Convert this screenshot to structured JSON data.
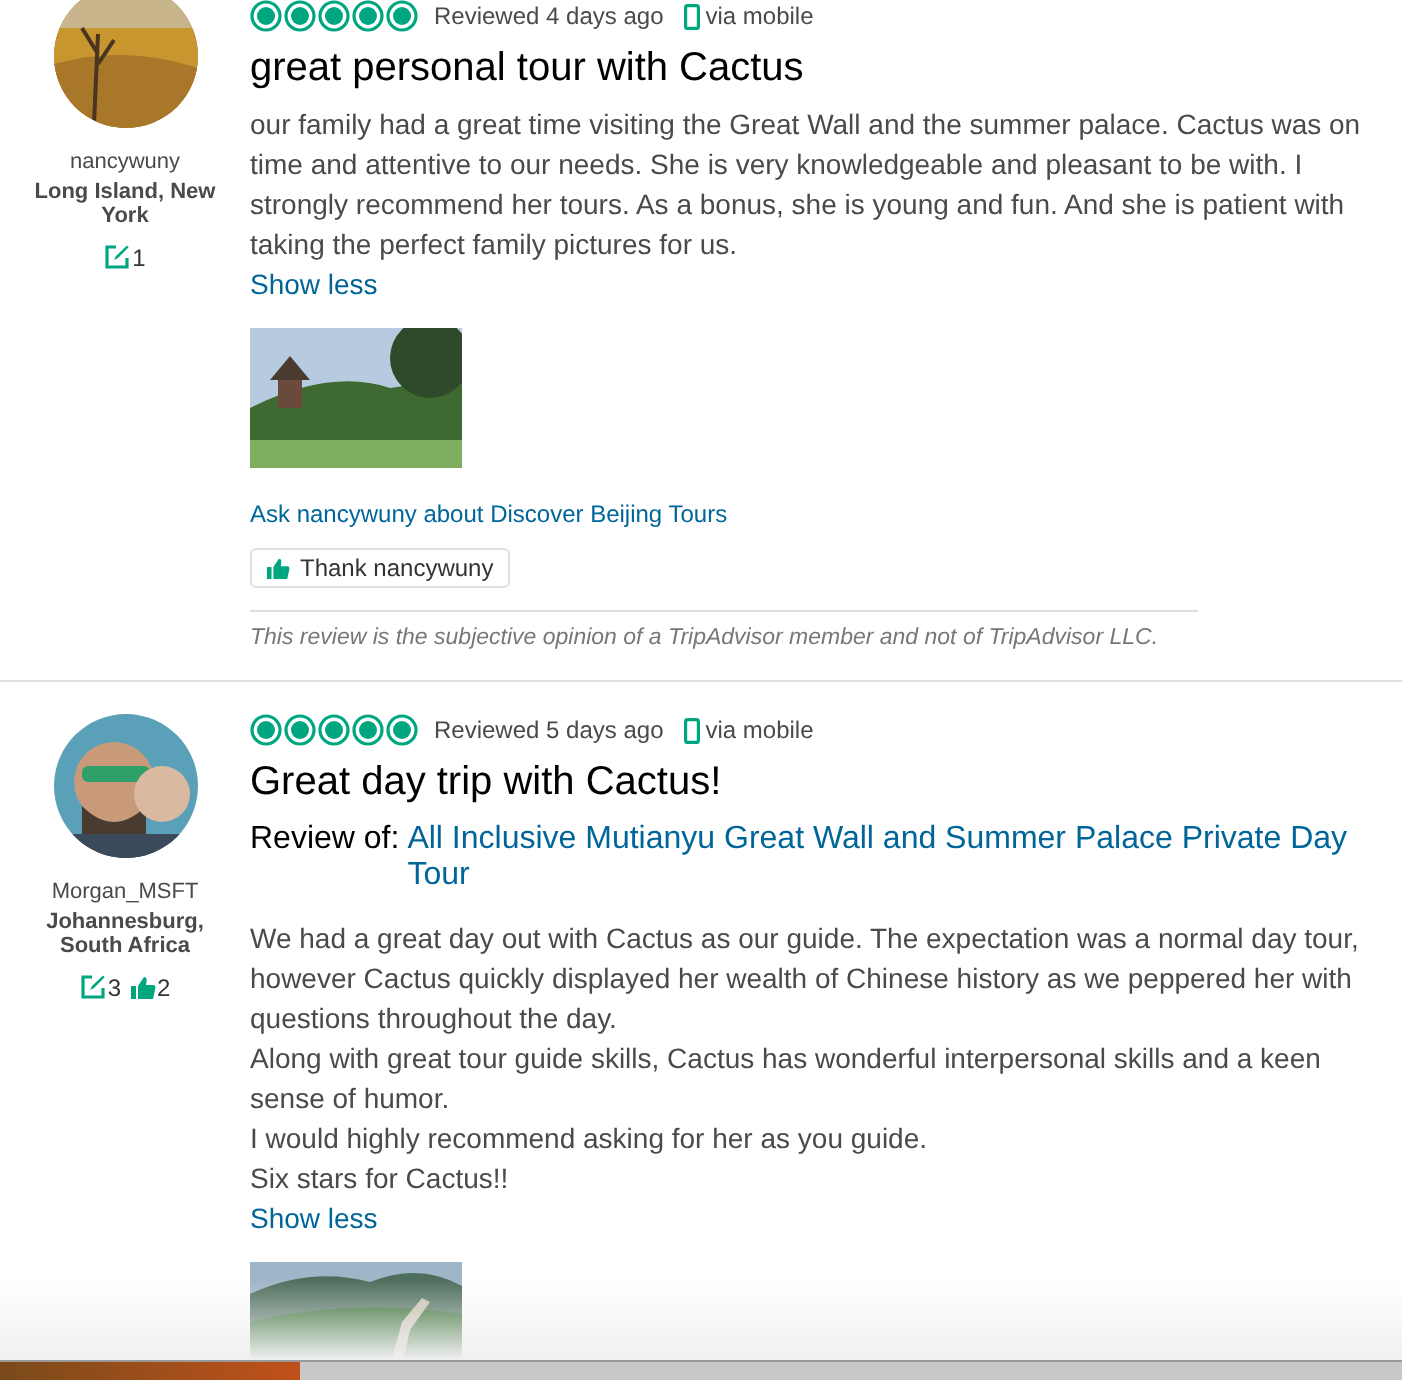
{
  "reviews": [
    {
      "username": "nancywuny",
      "location": "Long Island, New York",
      "badges": [
        {
          "kind": "reviews",
          "count": "1"
        }
      ],
      "stars": 5,
      "date": "Reviewed 4 days ago",
      "via": "via mobile",
      "title": "great personal tour with Cactus",
      "paragraphs": [
        "our family had a great time visiting the Great Wall and the summer palace. Cactus was on time and attentive to our needs. She is very knowledgeable and pleasant to be with. I strongly recommend her tours. As a bonus, she is young and fun. And she is patient with taking the perfect family pictures for us."
      ],
      "toggle": "Show less",
      "photo": {
        "kind": "picture"
      },
      "ask_link": "Ask nancywuny about Discover Beijing Tours",
      "thank_button": "Thank nancywuny",
      "disclaimer": "This review is the subjective opinion of a TripAdvisor member and not of TripAdvisor LLC."
    },
    {
      "username": "Morgan_MSFT",
      "location": "Johannesburg, South Africa",
      "badges": [
        {
          "kind": "reviews",
          "count": "3"
        },
        {
          "kind": "helpful",
          "count": "2"
        }
      ],
      "stars": 5,
      "date": "Reviewed 5 days ago",
      "via": "via mobile",
      "title": "Great day trip with Cactus!",
      "review_of_label": "Review of:",
      "review_of_link": "All Inclusive Mutianyu Great Wall and Summer Palace Private Day Tour",
      "paragraphs": [
        "We had a great day out with Cactus as our guide. The expectation was a normal day tour, however Cactus quickly displayed her wealth of Chinese history as we peppered her with questions throughout the day.",
        "Along with great tour guide skills, Cactus has wonderful interpersonal skills and a keen sense of humor.",
        "I would highly recommend asking for her as you guide.",
        "Six stars for Cactus!!"
      ],
      "toggle": "Show less",
      "photo": {
        "kind": "picture"
      }
    }
  ]
}
